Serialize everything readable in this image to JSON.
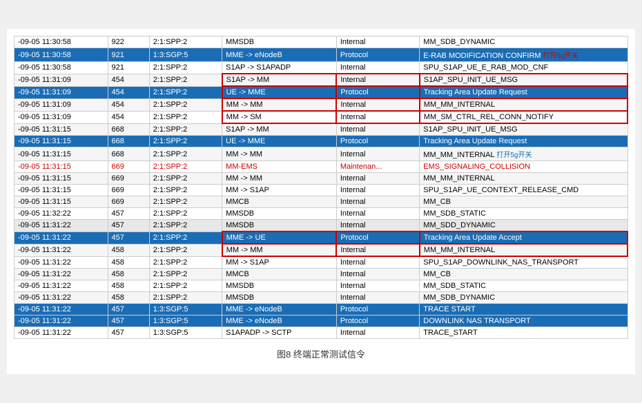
{
  "caption": "图8   终端正常测试信令",
  "rows": [
    {
      "time": "-09-05 11:30:58",
      "id": "922",
      "node": "2:1:SPP:2",
      "direction": "MMSDB",
      "type": "Internal",
      "message": "MM_SDB_DYNAMIC",
      "style": "normal"
    },
    {
      "time": "-09-05 11:30:58",
      "id": "921",
      "node": "1:3:SGP:5",
      "direction": "MME -> eNodeB",
      "type": "Protocol",
      "message": "E-RAB MODIFICATION CONFIRM",
      "style": "blue",
      "annotation": "打开5g开关",
      "ann_style": "red"
    },
    {
      "time": "-09-05 11:30:58",
      "id": "921",
      "node": "2:1:SPP:2",
      "direction": "S1AP -> S1APADP",
      "type": "Internal",
      "message": "SPU_S1AP_UE_E_RAB_MOD_CNF",
      "style": "normal"
    },
    {
      "time": "-09-05 11:31:09",
      "id": "454",
      "node": "2:1:SPP:2",
      "direction": "S1AP -> MM",
      "type": "Internal",
      "message": "S1AP_SPU_INIT_UE_MSG",
      "style": "normal",
      "bordered": true
    },
    {
      "time": "-09-05 11:31:09",
      "id": "454",
      "node": "2:1:SPP:2",
      "direction": "UE -> MME",
      "type": "Protocol",
      "message": "Tracking Area Update Request",
      "style": "blue",
      "bordered": true
    },
    {
      "time": "-09-05 11:31:09",
      "id": "454",
      "node": "2:1:SPP:2",
      "direction": "MM -> MM",
      "type": "Internal",
      "message": "MM_MM_INTERNAL",
      "style": "normal",
      "bordered": true
    },
    {
      "time": "-09-05 11:31:09",
      "id": "454",
      "node": "2:1:SPP:2",
      "direction": "MM -> SM",
      "type": "Internal",
      "message": "MM_SM_CTRL_REL_CONN_NOTIFY",
      "style": "normal",
      "bordered": true
    },
    {
      "time": "-09-05 11:31:15",
      "id": "668",
      "node": "2:1:SPP:2",
      "direction": "S1AP -> MM",
      "type": "Internal",
      "message": "S1AP_SPU_INIT_UE_MSG",
      "style": "normal"
    },
    {
      "time": "-09-05 11:31:15",
      "id": "668",
      "node": "2:1:SPP:2",
      "direction": "UE -> MME",
      "type": "Protocol",
      "message": "Tracking Area Update Request",
      "style": "blue"
    },
    {
      "time": "-09-05 11:31:15",
      "id": "668",
      "node": "2:1:SPP:2",
      "direction": "MM -> MM",
      "type": "Internal",
      "message": "MM_MM_INTERNAL",
      "style": "normal",
      "annotation2": "打开5g开关",
      "ann2_style": "blue"
    },
    {
      "time": "-09-05 11:31:15",
      "id": "669",
      "node": "2:1:SPP:2",
      "direction": "MM-EMS",
      "type": "Maintenan...",
      "message": "EMS_SIGNALING_COLLISION",
      "style": "red-text"
    },
    {
      "time": "-09-05 11:31:15",
      "id": "669",
      "node": "2:1:SPP:2",
      "direction": "MM -> MM",
      "type": "Internal",
      "message": "MM_MM_INTERNAL",
      "style": "normal"
    },
    {
      "time": "-09-05 11:31:15",
      "id": "669",
      "node": "2:1:SPP:2",
      "direction": "MM -> S1AP",
      "type": "Internal",
      "message": "SPU_S1AP_UE_CONTEXT_RELEASE_CMD",
      "style": "normal"
    },
    {
      "time": "-09-05 11:31:15",
      "id": "669",
      "node": "2:1:SPP:2",
      "direction": "MMCB",
      "type": "Internal",
      "message": "MM_CB",
      "style": "normal"
    },
    {
      "time": "-09-05 11:32:22",
      "id": "457",
      "node": "2:1:SPP:2",
      "direction": "MMSDB",
      "type": "Internal",
      "message": "MM_SDB_STATIC",
      "style": "normal"
    },
    {
      "time": "-09-05 11:31:22",
      "id": "457",
      "node": "2:1:SPP:2",
      "direction": "MMSDB",
      "type": "Internal",
      "message": "MM_SDD_DYNAMIC",
      "style": "striped"
    },
    {
      "time": "-09-05 11:31:22",
      "id": "457",
      "node": "2:1:SPP:2",
      "direction": "MME -> UE",
      "type": "Protocol",
      "message": "Tracking Area Update Accept",
      "style": "blue",
      "bordered": true
    },
    {
      "time": "-09-05 11:31:22",
      "id": "458",
      "node": "2:1:SPP:2",
      "direction": "MM -> MM",
      "type": "Internal",
      "message": "MM_MM_INTERNAL",
      "style": "normal",
      "bordered": true
    },
    {
      "time": "-09-05 11:31:22",
      "id": "458",
      "node": "2:1:SPP:2",
      "direction": "MM -> S1AP",
      "type": "Internal",
      "message": "SPU_S1AP_DOWNLINK_NAS_TRANSPORT",
      "style": "normal"
    },
    {
      "time": "-09-05 11:31:22",
      "id": "458",
      "node": "2:1:SPP:2",
      "direction": "MMCB",
      "type": "Internal",
      "message": "MM_CB",
      "style": "normal"
    },
    {
      "time": "-09-05 11:31:22",
      "id": "458",
      "node": "2:1:SPP:2",
      "direction": "MMSDB",
      "type": "Internal",
      "message": "MM_SDB_STATIC",
      "style": "normal"
    },
    {
      "time": "-09-05 11:31:22",
      "id": "458",
      "node": "2:1:SPP:2",
      "direction": "MMSDB",
      "type": "Internal",
      "message": "MM_SDB_DYNAMIC",
      "style": "normal"
    },
    {
      "time": "-09-05 11:31:22",
      "id": "457",
      "node": "1:3:SGP:5",
      "direction": "MME -> eNodeB",
      "type": "Protocol",
      "message": "TRACE START",
      "style": "blue"
    },
    {
      "time": "-09-05 11:31:22",
      "id": "457",
      "node": "1:3:SGP:5",
      "direction": "MME -> eNodeB",
      "type": "Protocol",
      "message": "DOWNLINK NAS TRANSPORT",
      "style": "blue"
    },
    {
      "time": "-09-05 11:31:22",
      "id": "457",
      "node": "1:3:SGP:5",
      "direction": "S1APADP -> SCTP",
      "type": "Internal",
      "message": "TRACE_START",
      "style": "normal"
    }
  ]
}
